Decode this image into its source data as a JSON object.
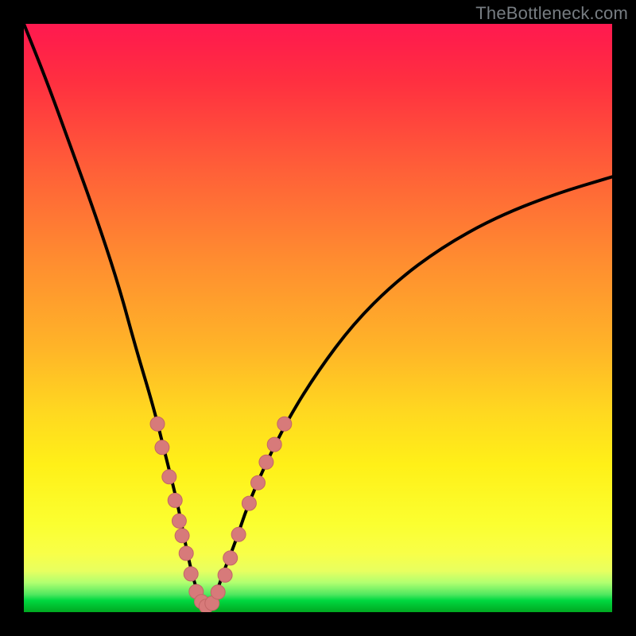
{
  "watermark": "TheBottleneck.com",
  "colors": {
    "frame": "#000000",
    "curve": "#000000",
    "marker_fill": "#d77a7a",
    "marker_stroke": "#c36666"
  },
  "chart_data": {
    "type": "line",
    "title": "",
    "xlabel": "",
    "ylabel": "",
    "xlim": [
      0,
      100
    ],
    "ylim": [
      0,
      100
    ],
    "grid": false,
    "legend": null,
    "series": [
      {
        "name": "bottleneck-curve",
        "x": [
          0,
          4,
          8,
          12,
          16,
          19,
          22,
          24,
          26,
          27,
          28,
          29,
          30,
          31,
          32,
          33,
          34,
          36,
          38,
          41,
          45,
          50,
          56,
          63,
          71,
          80,
          90,
          100
        ],
        "y": [
          100,
          90,
          79,
          68,
          56,
          45,
          35,
          27,
          19,
          14,
          9,
          5,
          2,
          1,
          2,
          4,
          7,
          12,
          18,
          25,
          33,
          41,
          49,
          56,
          62,
          67,
          71,
          74
        ]
      }
    ],
    "markers": [
      {
        "x": 22.7,
        "y": 32
      },
      {
        "x": 23.5,
        "y": 28
      },
      {
        "x": 24.7,
        "y": 23
      },
      {
        "x": 25.7,
        "y": 19
      },
      {
        "x": 26.4,
        "y": 15.5
      },
      {
        "x": 26.9,
        "y": 13
      },
      {
        "x": 27.6,
        "y": 10
      },
      {
        "x": 28.4,
        "y": 6.5
      },
      {
        "x": 29.3,
        "y": 3.5
      },
      {
        "x": 30.2,
        "y": 1.8
      },
      {
        "x": 31.0,
        "y": 1.0
      },
      {
        "x": 32.0,
        "y": 1.5
      },
      {
        "x": 33.0,
        "y": 3.4
      },
      {
        "x": 34.2,
        "y": 6.3
      },
      {
        "x": 35.1,
        "y": 9.2
      },
      {
        "x": 36.5,
        "y": 13.2
      },
      {
        "x": 38.3,
        "y": 18.5
      },
      {
        "x": 39.8,
        "y": 22
      },
      {
        "x": 41.2,
        "y": 25.5
      },
      {
        "x": 42.6,
        "y": 28.5
      },
      {
        "x": 44.3,
        "y": 32
      }
    ]
  }
}
